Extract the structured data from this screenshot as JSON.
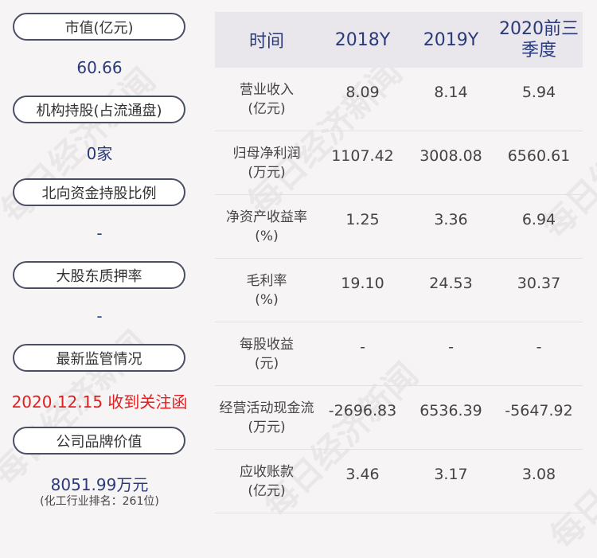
{
  "left_panel": {
    "items": [
      {
        "label": "市值(亿元)",
        "value": "60.66"
      },
      {
        "label": "机构持股(占流通盘)",
        "value": "0家"
      },
      {
        "label": "北向资金持股比例",
        "value": "-"
      },
      {
        "label": "大股东质押率",
        "value": "-"
      },
      {
        "label": "最新监管情况",
        "value": "2020.12.15 收到关注函"
      },
      {
        "label": "公司品牌价值",
        "value": "8051.99万元",
        "sub": "(化工行业排名：261位)"
      }
    ]
  },
  "table": {
    "headers": [
      "时间",
      "2018Y",
      "2019Y",
      "2020前三季度"
    ],
    "rows": [
      {
        "name": "营业收入",
        "unit": "(亿元)",
        "values": [
          "8.09",
          "8.14",
          "5.94"
        ]
      },
      {
        "name": "归母净利润",
        "unit": "(万元)",
        "values": [
          "1107.42",
          "3008.08",
          "6560.61"
        ]
      },
      {
        "name": "净资产收益率",
        "unit": "(%)",
        "values": [
          "1.25",
          "3.36",
          "6.94"
        ]
      },
      {
        "name": "毛利率",
        "unit": "(%)",
        "values": [
          "19.10",
          "24.53",
          "30.37"
        ]
      },
      {
        "name": "每股收益",
        "unit": "(元)",
        "values": [
          "-",
          "-",
          "-"
        ]
      },
      {
        "name": "经营活动现金流",
        "unit": "(万元)",
        "values": [
          "-2696.83",
          "6536.39",
          "-5647.92"
        ]
      },
      {
        "name": "应收账款",
        "unit": "(亿元)",
        "values": [
          "3.46",
          "3.17",
          "3.08"
        ]
      }
    ]
  },
  "watermark": "每日经济新闻",
  "colors": {
    "value_blue": "#2b3a7a",
    "alert_red": "#e02020",
    "pill_border": "#4a4f63",
    "header_bg": "#e9e7ec"
  }
}
